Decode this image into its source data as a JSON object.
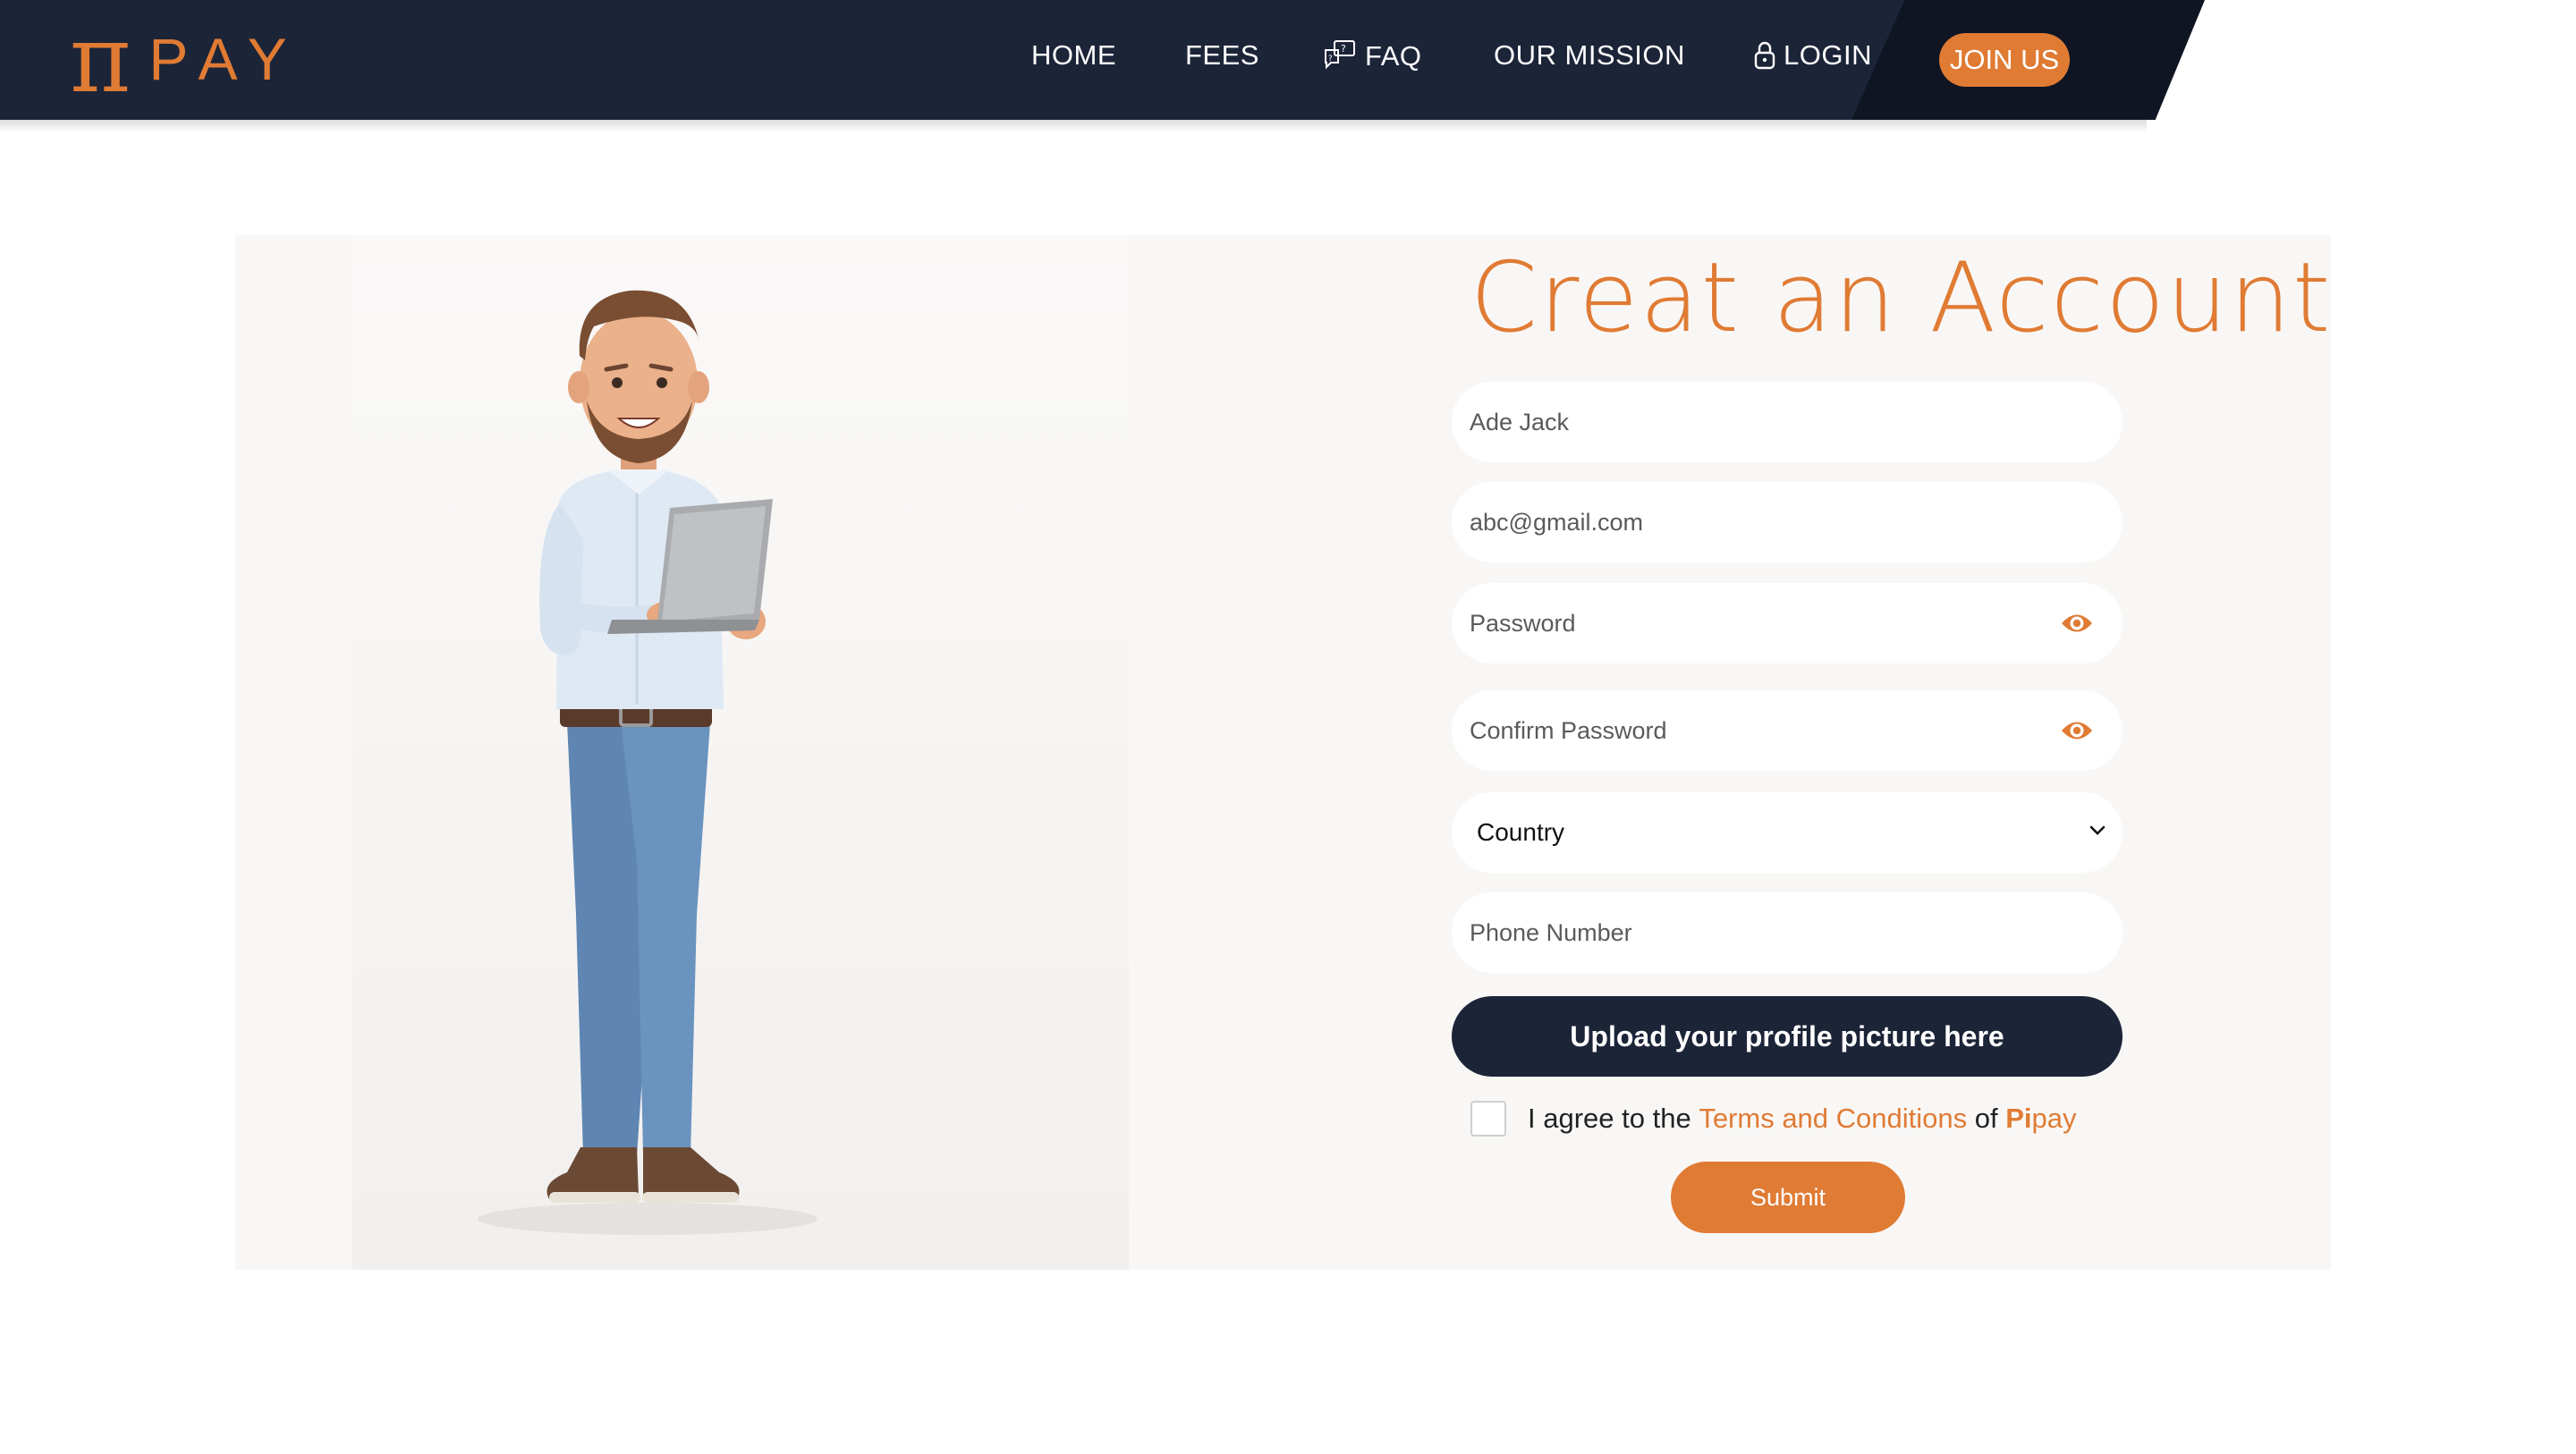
{
  "colors": {
    "navy": "#1c2438",
    "accent": "#e07b34",
    "panel": "#f9f7f5"
  },
  "nav": {
    "logo_symbol": "π",
    "logo_text": "PAY",
    "items": [
      {
        "label": "HOME"
      },
      {
        "label": "FEES"
      },
      {
        "label": "FAQ",
        "icon": "chat-question-icon"
      },
      {
        "label": "OUR MISSION"
      },
      {
        "label": "LOGIN",
        "icon": "lock-icon"
      }
    ],
    "join_label": "JOIN US"
  },
  "form": {
    "title": "Creat an Account",
    "name_value": "Ade Jack",
    "email_value": "abc@gmail.com",
    "password_placeholder": "Password",
    "confirm_placeholder": "Confirm Password",
    "country_selected": "Country",
    "phone_placeholder": "Phone Number",
    "upload_label": "Upload your profile picture here",
    "agree_prefix": "I agree to the ",
    "agree_link": "Terms and Conditions",
    "agree_of": " of ",
    "brand_bold": "Pi",
    "brand_rest": "pay",
    "submit_label": "Submit"
  }
}
